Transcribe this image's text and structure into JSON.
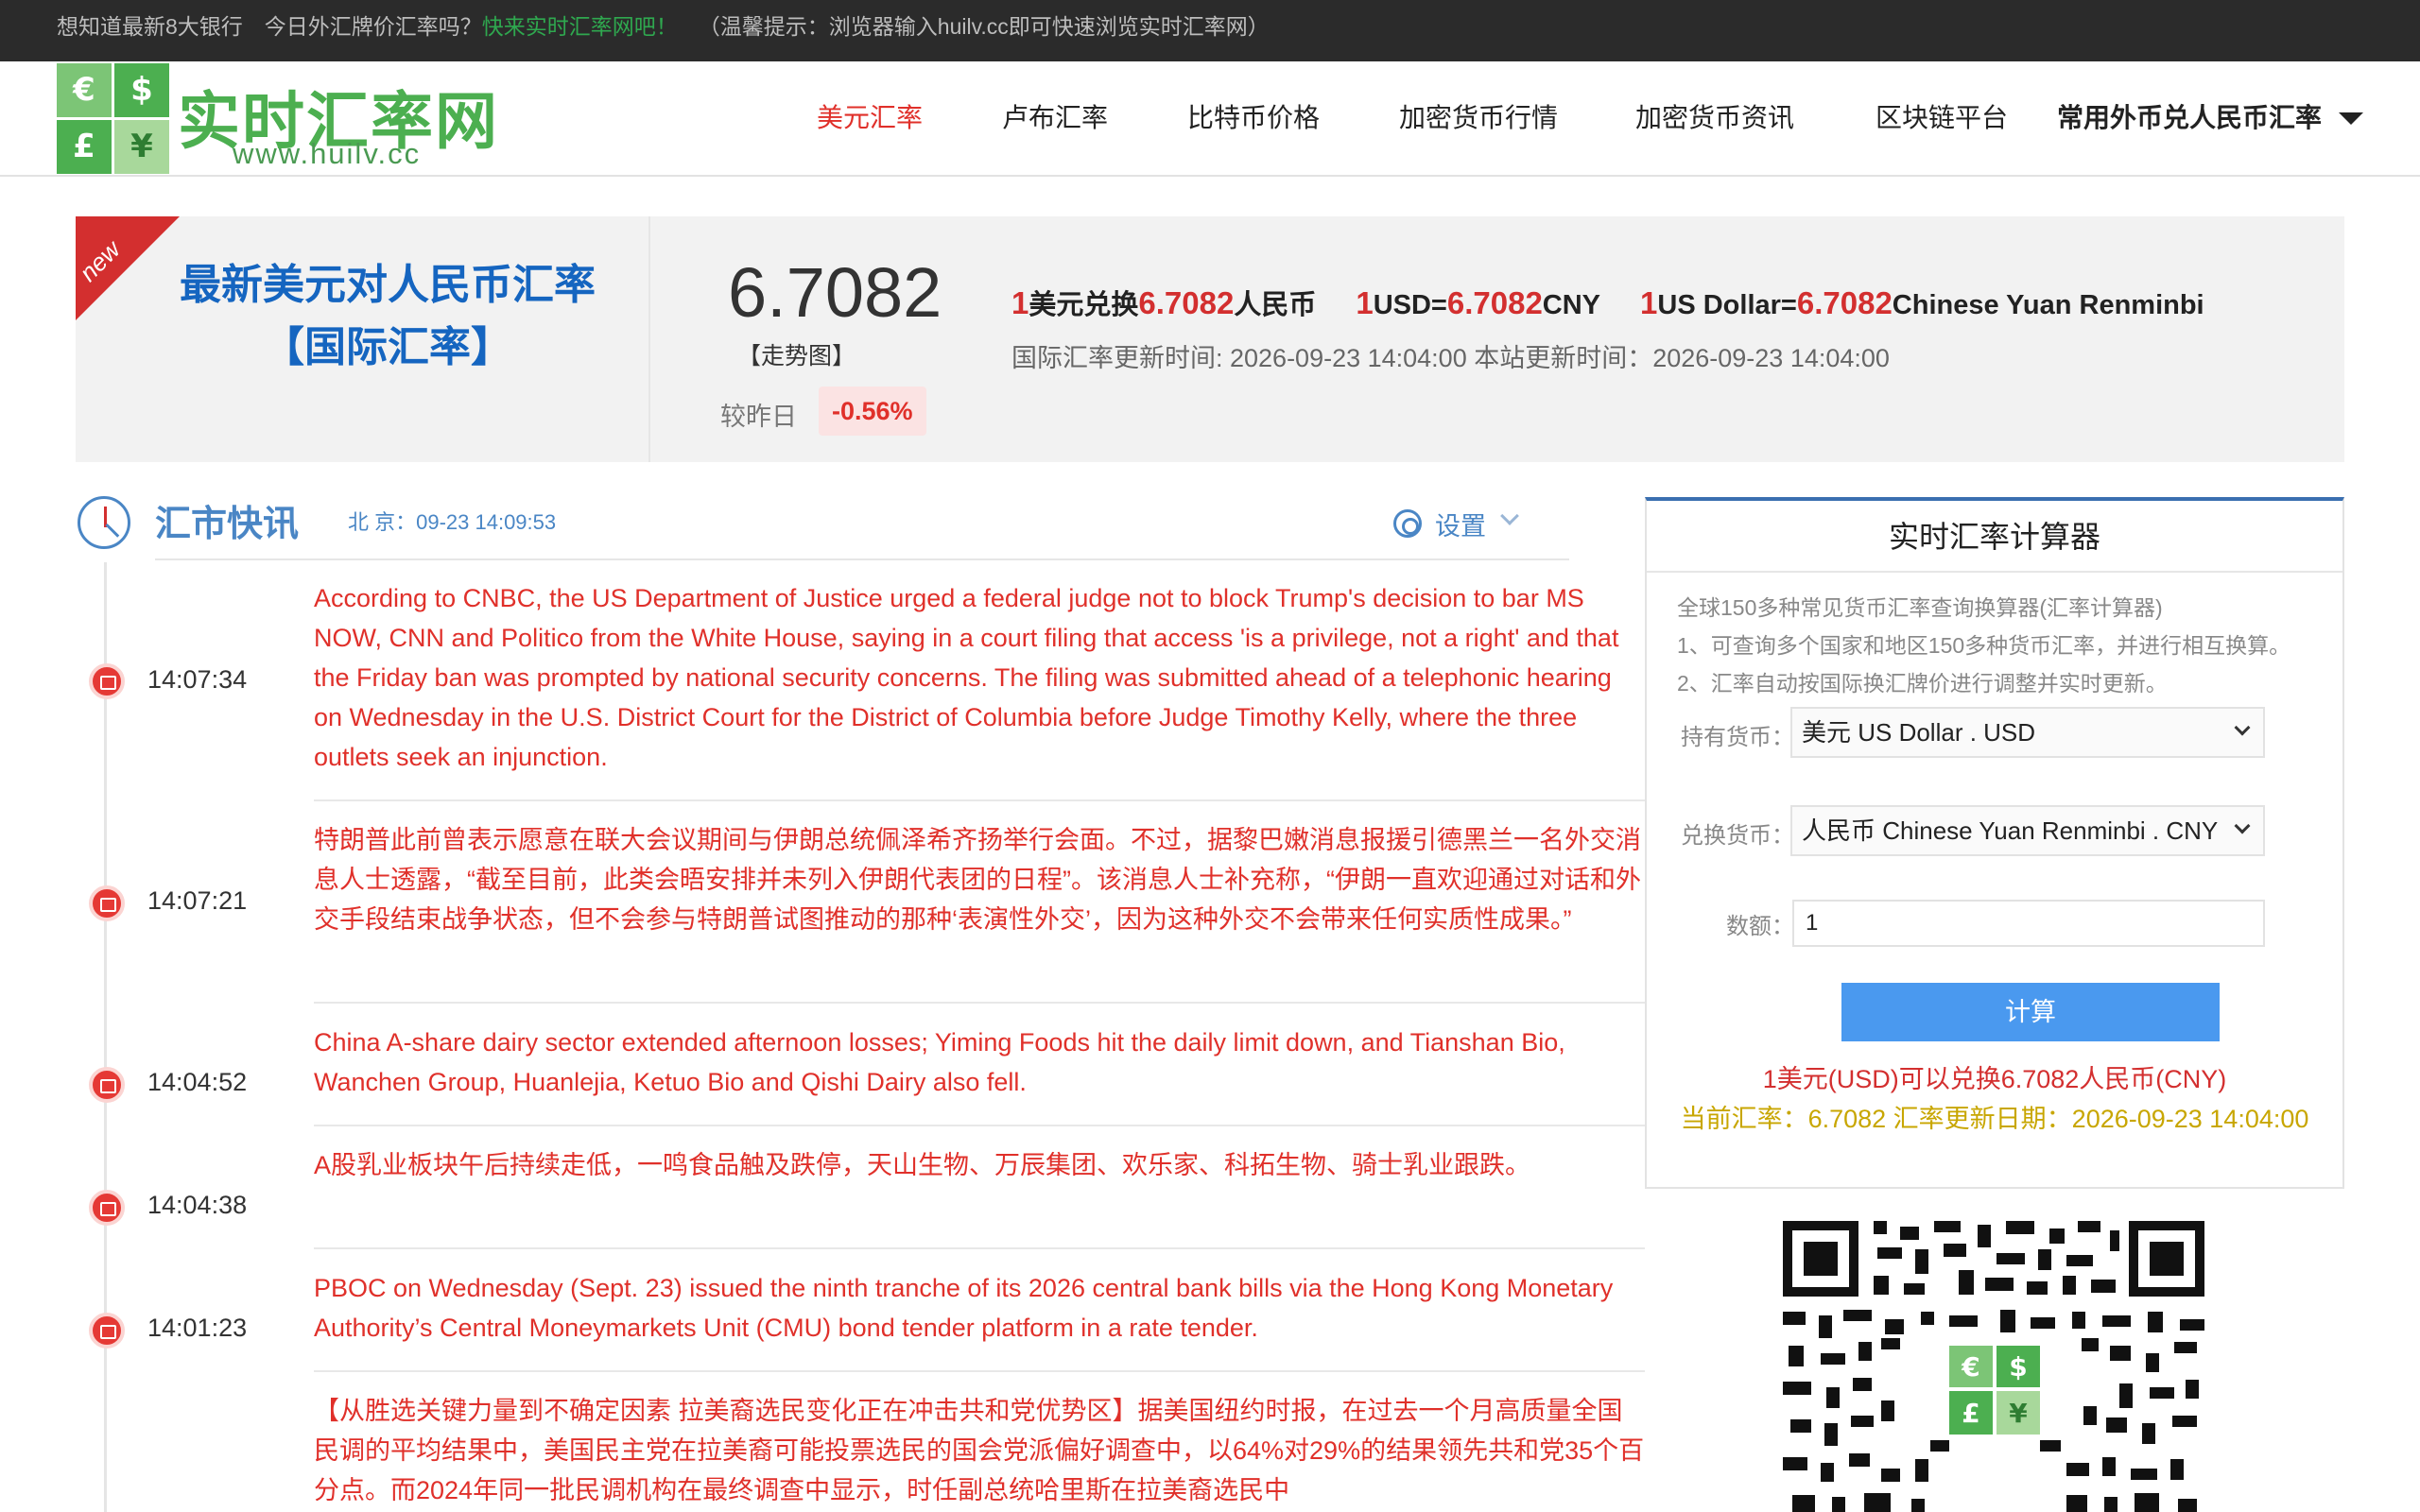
{
  "topbar": {
    "text1": "想知道最新8大银行　今日外汇牌价汇率吗？",
    "link": "快来实时汇率网吧！",
    "tip": "（温馨提示：浏览器输入huilv.cc即可快速浏览实时汇率网）"
  },
  "logo": {
    "symbols": [
      "€",
      "$",
      "£",
      "¥"
    ],
    "name": "实时汇率网",
    "url": "www.huilv.cc"
  },
  "nav": {
    "items": [
      "美元汇率",
      "卢布汇率",
      "比特币价格",
      "加密货币行情",
      "加密货币资讯",
      "区块链平台",
      "常用外币兑人民币汇率"
    ]
  },
  "rate": {
    "badge": "new",
    "title_line1": "最新美元对人民币汇率",
    "title_line2": "【国际汇率】",
    "value": "6.7082",
    "trend": "【走势图】",
    "vs_yesterday": "较昨日",
    "change": "-0.56%",
    "conv1": {
      "num": "1",
      "from": "美元兑换",
      "rate": "6.7082",
      "to": "人民币"
    },
    "conv2": {
      "num": "1",
      "from": "USD=",
      "rate": "6.7082",
      "to": "CNY"
    },
    "conv3": {
      "num": "1",
      "from": "US Dollar=",
      "rate": "6.7082",
      "to": "Chinese Yuan Renminbi"
    },
    "update_text": "国际汇率更新时间: 2026-09-23 14:04:00 本站更新时间：2026-09-23 14:04:00"
  },
  "news": {
    "title": "汇市快讯",
    "beijing_time": "北 京：09-23 14:09:53",
    "settings": "设置",
    "items": [
      {
        "time": "14:07:34",
        "text": "According to CNBC, the US Department of Justice urged a federal judge not to block Trump's decision to bar MS NOW, CNN and Politico from the White House, saying in a court filing that access 'is a privilege, not a right' and that the Friday ban was prompted by national security concerns. The filing was submitted ahead of a telephonic hearing on Wednesday in the U.S. District Court for the District of Columbia before Judge Timothy Kelly, where the three outlets seek an injunction."
      },
      {
        "time": "14:07:21",
        "text": "特朗普此前曾表示愿意在联大会议期间与伊朗总统佩泽希齐扬举行会面。不过，据黎巴嫩消息报援引德黑兰一名外交消息人士透露，“截至目前，此类会晤安排并未列入伊朗代表团的日程”。该消息人士补充称，“伊朗一直欢迎通过对话和外交手段结束战争状态，但不会参与特朗普试图推动的那种‘表演性外交’，因为这种外交不会带来任何实质性成果。”"
      },
      {
        "time": "14:04:52",
        "text": "China A-share dairy sector extended afternoon losses; Yiming Foods hit the daily limit down, and Tianshan Bio, Wanchen Group, Huanlejia, Ketuo Bio and Qishi Dairy also fell."
      },
      {
        "time": "14:04:38",
        "text": "A股乳业板块午后持续走低，一鸣食品触及跌停，天山生物、万辰集团、欢乐家、科拓生物、骑士乳业跟跌。"
      },
      {
        "time": "14:01:23",
        "text": "PBOC on Wednesday (Sept. 23) issued the ninth tranche of its 2026 central bank bills via the Hong Kong Monetary Authority’s Central Moneymarkets Unit (CMU) bond tender platform in a rate tender."
      },
      {
        "time": "",
        "text": "【从胜选关键力量到不确定因素 拉美裔选民变化正在冲击共和党优势区】据美国纽约时报，在过去一个月高质量全国民调的平均结果中，美国民主党在拉美裔可能投票选民的国会党派偏好调查中，以64%对29%的结果领先共和党35个百分点。而2024年同一批民调机构在最终调查中显示，时任副总统哈里斯在拉美裔选民中"
      }
    ]
  },
  "calculator": {
    "title": "实时汇率计算器",
    "desc": [
      "全球150多种常见货币汇率查询换算器(汇率计算器)",
      "1、可查询多个国家和地区150多种货币汇率，并进行相互换算。",
      "2、汇率自动按国际换汇牌价进行调整并实时更新。"
    ],
    "hold_label": "持有货币：",
    "hold_value": "美元 US Dollar . USD",
    "exchange_label": "兑换货币：",
    "exchange_value": "人民币 Chinese Yuan Renminbi . CNY",
    "amount_label": "数额：",
    "amount_value": "1",
    "button": "计算",
    "result1": "1美元(USD)可以兑换6.7082人民币(CNY)",
    "result2": "当前汇率：6.7082 汇率更新日期：2026-09-23 14:04:00"
  }
}
